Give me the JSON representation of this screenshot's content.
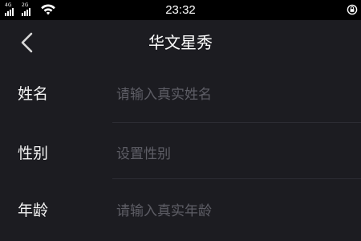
{
  "status_bar": {
    "time": "23:32",
    "network_1": "4G",
    "network_2": "2G",
    "signal_icon": "signal-bars-icon",
    "wifi_icon": "wifi-icon",
    "right_icon": "lock-rotation-icon"
  },
  "nav": {
    "title": "华文星秀",
    "back_icon": "chevron-left-icon"
  },
  "form": {
    "name": {
      "label": "姓名",
      "placeholder": "请输入真实姓名",
      "value": ""
    },
    "gender": {
      "label": "性别",
      "value_text": "设置性别"
    },
    "age": {
      "label": "年龄",
      "placeholder": "请输入真实年龄",
      "value": ""
    }
  },
  "colors": {
    "background": "#1c1c21",
    "status_bar": "#000000",
    "placeholder": "#5e5e66",
    "divider": "#2c2c33"
  }
}
